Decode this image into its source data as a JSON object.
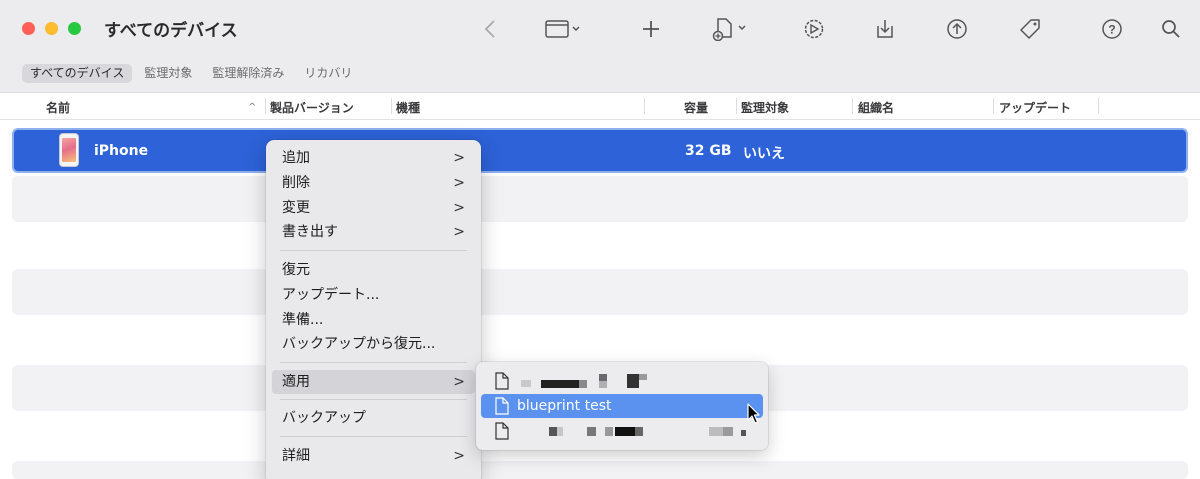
{
  "window": {
    "title": "すべてのデバイス",
    "colors": {
      "close": "#ff5f57",
      "minimize": "#febc2e",
      "zoom": "#28c840",
      "selection": "#2d62d8",
      "submenu_selection": "#5b92f0"
    }
  },
  "toolbar": {
    "icons": [
      "back-chevron-icon",
      "view-toggle-icon",
      "add-icon",
      "add-file-icon",
      "settings-gear-icon",
      "download-icon",
      "upload-icon",
      "tag-icon",
      "help-icon",
      "search-icon"
    ]
  },
  "scope_bar": {
    "items": [
      {
        "label": "すべてのデバイス",
        "active": true
      },
      {
        "label": "監理対象",
        "active": false
      },
      {
        "label": "監理解除済み",
        "active": false
      },
      {
        "label": "リカバリ",
        "active": false
      }
    ]
  },
  "table": {
    "columns": [
      "名前",
      "製品バージョン",
      "機種",
      "容量",
      "監理対象",
      "組織名",
      "アップデート"
    ],
    "sort_indicator": "^",
    "rows": [
      {
        "name": "iPhone",
        "capacity": "32 GB",
        "supervised": "いいえ",
        "selected": true
      }
    ]
  },
  "context_menu": {
    "items": [
      {
        "label": "追加",
        "submenu": true
      },
      {
        "label": "削除",
        "submenu": true
      },
      {
        "label": "変更",
        "submenu": true
      },
      {
        "label": "書き出す",
        "submenu": true
      },
      {
        "label": "復元",
        "submenu": false
      },
      {
        "label": "アップデート...",
        "submenu": false
      },
      {
        "label": "準備...",
        "submenu": false
      },
      {
        "label": "バックアップから復元...",
        "submenu": false
      },
      {
        "label": "適用",
        "submenu": true,
        "highlighted": true
      },
      {
        "label": "バックアップ",
        "submenu": false
      },
      {
        "label": "詳細",
        "submenu": true
      }
    ],
    "chevron": ">"
  },
  "apply_submenu": {
    "items": [
      {
        "label": "",
        "redacted": true
      },
      {
        "label": "blueprint test",
        "selected": true
      },
      {
        "label": "",
        "redacted": true
      }
    ]
  }
}
